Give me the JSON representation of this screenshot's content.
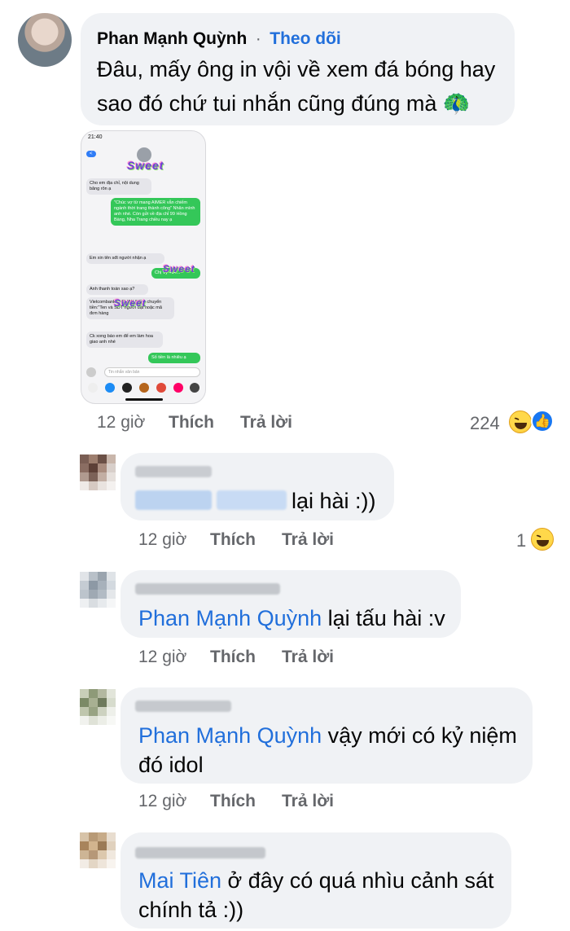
{
  "post": {
    "author": "Phan Mạnh Quỳnh",
    "separator": "·",
    "follow_label": "Theo dõi",
    "text_line1": "Đâu, mấy ông in vội về xem đá bóng hay",
    "text_line2": "sao đó chứ tui nhắn cũng đúng mà 🦚",
    "time": "12 giờ",
    "like_label": "Thích",
    "reply_label": "Trả lời",
    "reaction_count": "224",
    "image": {
      "status_time": "21:40",
      "back_badge": "<",
      "sticker_text": "Sweet",
      "messages": [
        {
          "side": "in",
          "text": "Cho em địa chỉ, nội dung băng rôn ạ"
        },
        {
          "side": "out",
          "text": "\"Chúc vợ từ mang AIMER vẫn chiếm ngành thời trang thành công\" Nhân mình anh nhé. Còn gửi về địa chỉ 99 Hồng Bàng, Nha Trang chiều nay ạ"
        },
        {
          "side": "in",
          "text": "Em xin tên sđt người nhận ạ"
        },
        {
          "side": "out",
          "text": "Chị Vy +84..."
        },
        {
          "side": "in",
          "text": "Anh thanh toán sao ạ?"
        },
        {
          "side": "in",
          "text": "Vietcombank ... PHAN NG... chuyển tiền:\"Ten và SDT người đặt hoặc mã đơn hàng"
        },
        {
          "side": "in",
          "text": "Ck xong báo em để em làm hoa giao anh nhé"
        },
        {
          "side": "out",
          "text": "Số tiền là nhiêu ạ"
        }
      ],
      "input_placeholder": "Tin nhắn văn bản"
    }
  },
  "comments": [
    {
      "text": "lại hài :))",
      "time": "12 giờ",
      "like_label": "Thích",
      "reply_label": "Trả lời",
      "reaction_count": "1"
    },
    {
      "mention": "Phan Mạnh Quỳnh",
      "text": " lại tấu hài :v",
      "time": "12 giờ",
      "like_label": "Thích",
      "reply_label": "Trả lời"
    },
    {
      "mention": "Phan Mạnh Quỳnh",
      "text_line1": " vậy mới có kỷ niệm",
      "text_line2": "đó idol",
      "time": "12 giờ",
      "like_label": "Thích",
      "reply_label": "Trả lời"
    },
    {
      "mention": "Mai Tiên",
      "text_line1": " ở đây có quá nhìu cảnh sát",
      "text_line2": "chính tả :))"
    }
  ],
  "colors": {
    "bubble": "#f0f2f5",
    "link": "#216fdb",
    "meta": "#65676b",
    "like_blue": "#1877f2"
  }
}
